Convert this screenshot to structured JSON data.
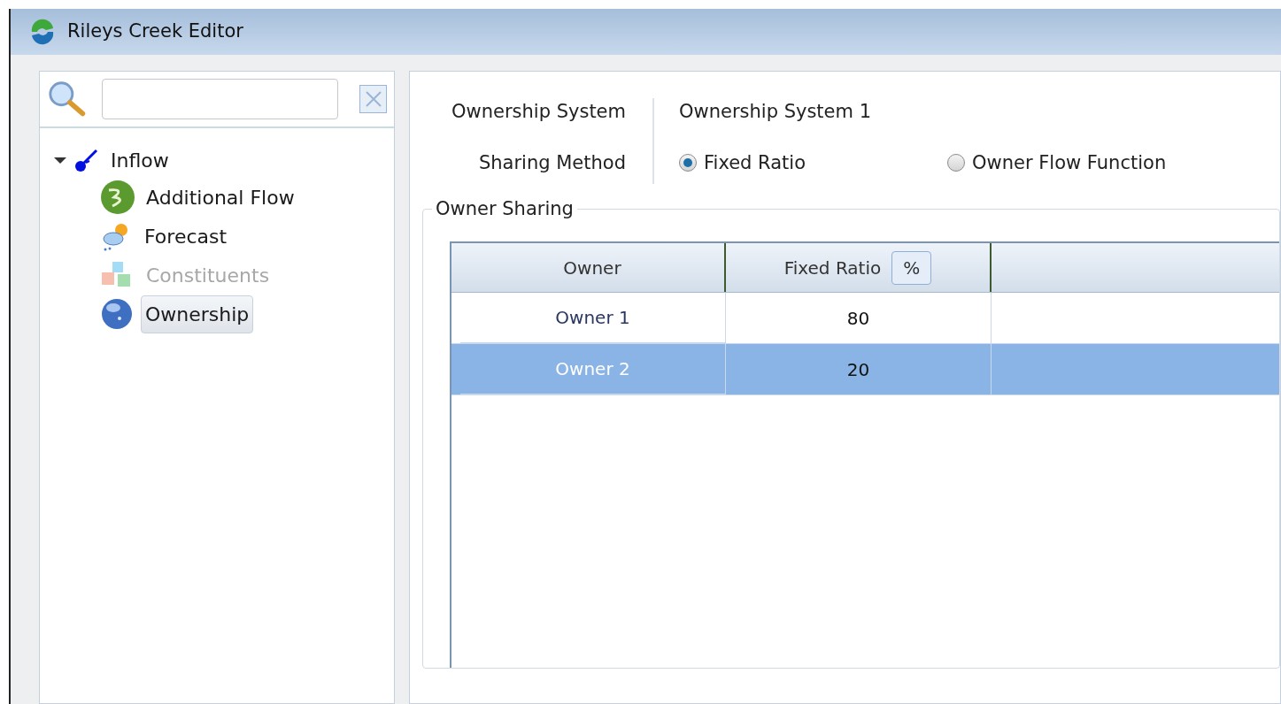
{
  "window": {
    "title": "Rileys Creek Editor"
  },
  "tree": [
    {
      "label": "Inflow",
      "kind": "inflow",
      "expanded": true,
      "selected": false,
      "disabled": false,
      "children": [
        {
          "label": "Additional Flow",
          "kind": "flow",
          "selected": false,
          "disabled": false
        },
        {
          "label": "Forecast",
          "kind": "forecast",
          "selected": false,
          "disabled": false
        },
        {
          "label": "Constituents",
          "kind": "constituents",
          "selected": false,
          "disabled": true
        },
        {
          "label": "Ownership",
          "kind": "ownership",
          "selected": true,
          "disabled": false
        }
      ]
    }
  ],
  "form": {
    "system_label": "Ownership System",
    "system_value": "Ownership System 1",
    "method_label": "Sharing Method",
    "methods": [
      {
        "label": "Fixed Ratio",
        "selected": true
      },
      {
        "label": "Owner Flow Function",
        "selected": false
      }
    ]
  },
  "owner_sharing": {
    "title": "Owner Sharing",
    "columns": [
      {
        "label": "Owner"
      },
      {
        "label": "Fixed Ratio",
        "unit": "%"
      }
    ],
    "rows": [
      {
        "owner": "Owner 1",
        "ratio": "80",
        "selected": false
      },
      {
        "owner": "Owner 2",
        "ratio": "20",
        "selected": true
      }
    ]
  }
}
